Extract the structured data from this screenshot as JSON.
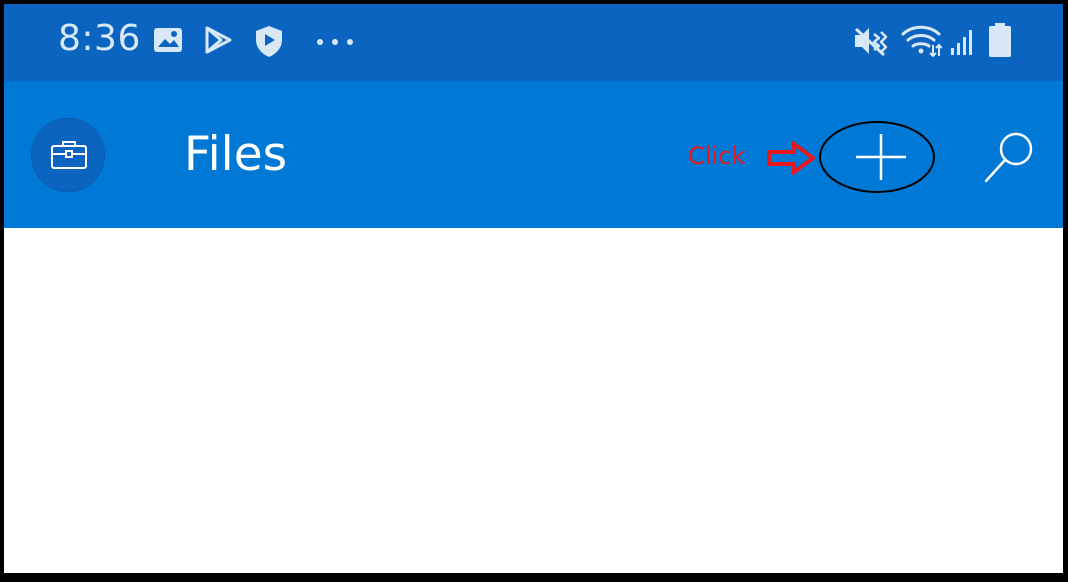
{
  "status_bar": {
    "time": "8:36",
    "left_icons": [
      "image-icon",
      "play-store-icon",
      "shield-play-icon",
      "more-dots-icon"
    ],
    "right_icons": [
      "vibrate-mute-icon",
      "wifi-icon",
      "signal-icon",
      "battery-icon"
    ]
  },
  "app_bar": {
    "title": "Files",
    "left_icon": "briefcase-icon",
    "actions": [
      "plus-icon",
      "search-icon"
    ]
  },
  "annotation": {
    "text": "Click",
    "color": "#e8171c"
  },
  "colors": {
    "status_bar": "#0b64bf",
    "app_bar": "#0079d6",
    "content": "#ffffff",
    "border": "#000000"
  }
}
